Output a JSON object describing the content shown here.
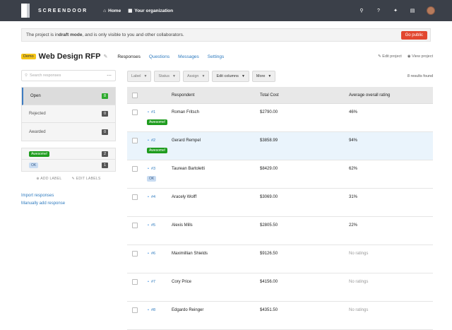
{
  "topbar": {
    "brand": "SCREENDOOR",
    "home_label": "Home",
    "org_label": "Your organization"
  },
  "banner": {
    "text_before": "The project is in ",
    "text_bold": "draft mode",
    "text_after": ", and is only visible to you and other collaborators.",
    "button_label": "Go public"
  },
  "project": {
    "badge": "Demo",
    "title": "Web Design RFP",
    "tabs": [
      "Responses",
      "Questions",
      "Messages",
      "Settings"
    ],
    "edit_label": "Edit project",
    "view_label": "View project"
  },
  "sidebar": {
    "search_placeholder": "Search responses",
    "statuses": [
      {
        "label": "Open",
        "count": "8"
      },
      {
        "label": "Rejected",
        "count": "0"
      },
      {
        "label": "Awarded",
        "count": "0"
      }
    ],
    "labels": [
      {
        "label": "Awesome!",
        "count": "2",
        "color": "#1e9c1e"
      },
      {
        "label": "OK",
        "count": "1",
        "color": "#c9dcf2"
      }
    ],
    "add_label": "ADD LABEL",
    "edit_labels": "EDIT LABELS",
    "links": [
      "Import responses",
      "Manually add response"
    ]
  },
  "toolbar": {
    "label": "Label",
    "status": "Status",
    "assign": "Assign",
    "edit_columns": "Edit columns",
    "more": "More",
    "results": "8 results found"
  },
  "table": {
    "headers": [
      "Respondent",
      "Total Cost",
      "Average overall rating"
    ],
    "rows": [
      {
        "num": "#1",
        "respondent": "Roman Fritsch",
        "cost": "$2790.00",
        "rating": "46%",
        "label": "Awesome!"
      },
      {
        "num": "#2",
        "respondent": "Gerard Rempel",
        "cost": "$3858.99",
        "rating": "94%",
        "label": "Awesome!"
      },
      {
        "num": "#3",
        "respondent": "Taurean Bartoletti",
        "cost": "$8429.00",
        "rating": "62%",
        "label": "OK"
      },
      {
        "num": "#4",
        "respondent": "Aracely Wolff",
        "cost": "$3069.00",
        "rating": "31%",
        "label": ""
      },
      {
        "num": "#5",
        "respondent": "Alexis Mills",
        "cost": "$2805.50",
        "rating": "22%",
        "label": ""
      },
      {
        "num": "#6",
        "respondent": "Maximillian Shields",
        "cost": "$9126.50",
        "rating": "No ratings",
        "label": ""
      },
      {
        "num": "#7",
        "respondent": "Cory Price",
        "cost": "$4156.00",
        "rating": "No ratings",
        "label": ""
      },
      {
        "num": "#8",
        "respondent": "Edgardo Reinger",
        "cost": "$4351.50",
        "rating": "No ratings",
        "label": ""
      }
    ]
  }
}
